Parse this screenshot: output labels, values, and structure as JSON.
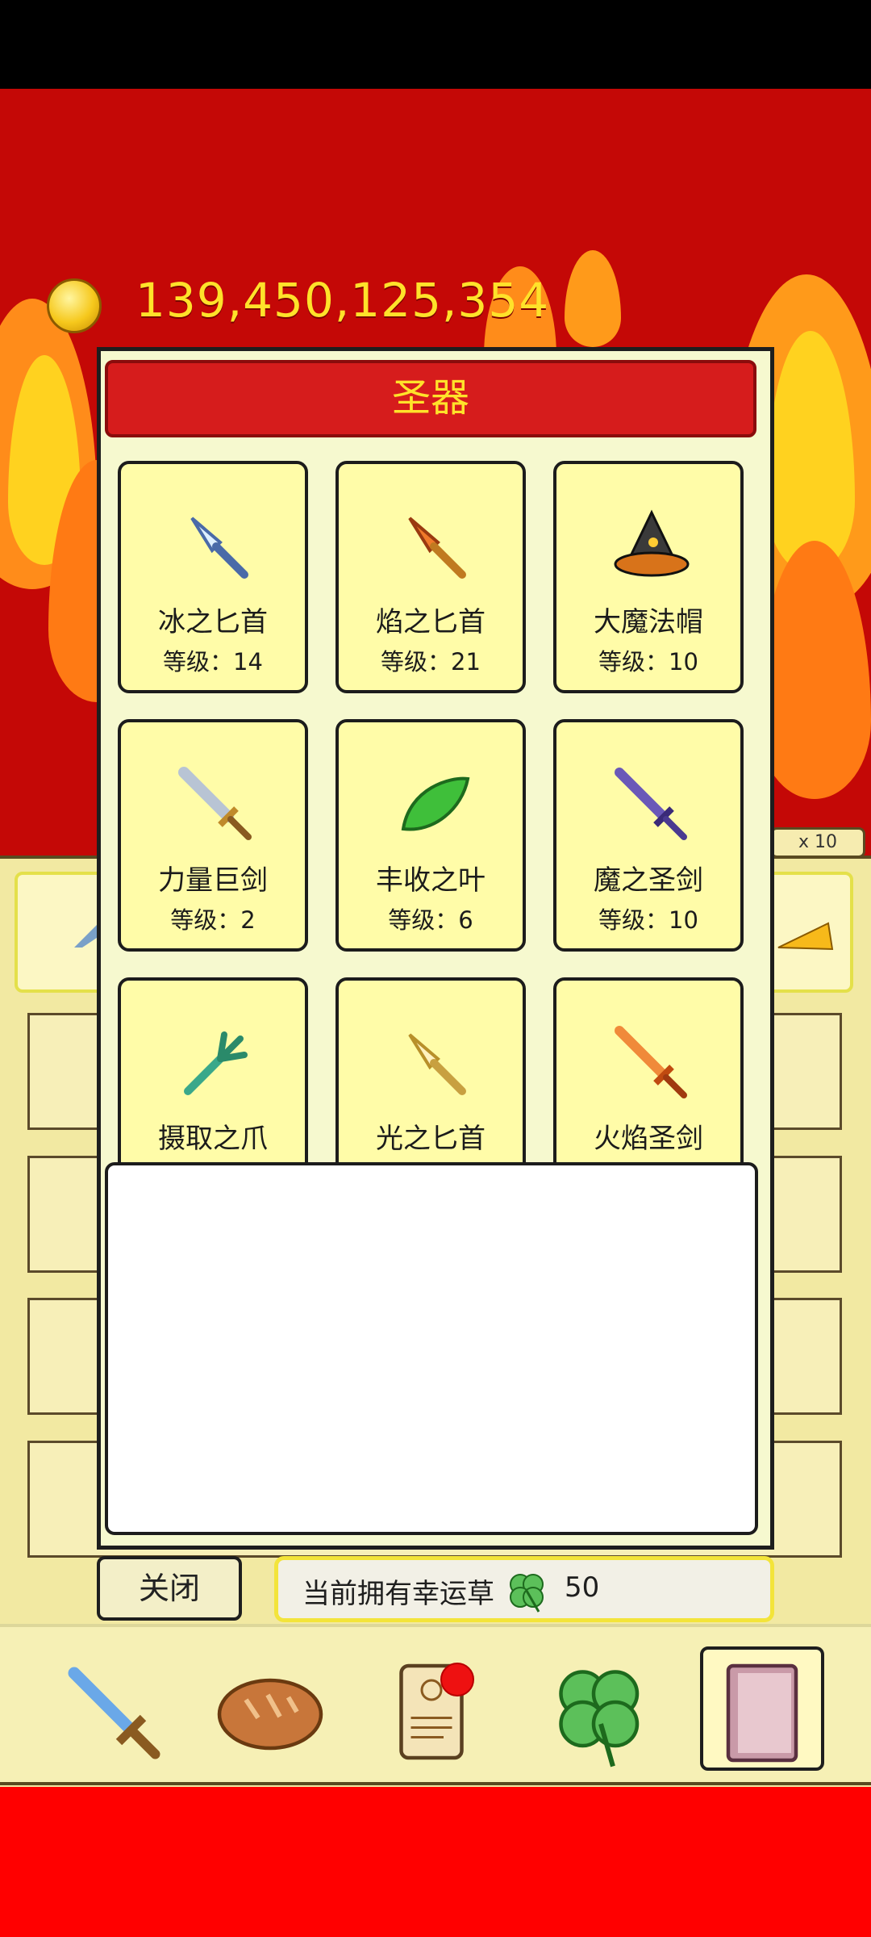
{
  "currency": {
    "amount": "139,450,125,354",
    "icon": "gold-coin-icon"
  },
  "multiplier_label": "x 10",
  "modal": {
    "title": "圣器",
    "items": [
      {
        "name": "冰之匕首",
        "level": "等级：14",
        "icon": "ice-dagger-icon"
      },
      {
        "name": "焰之匕首",
        "level": "等级：21",
        "icon": "flame-dagger-icon"
      },
      {
        "name": "大魔法帽",
        "level": "等级：10",
        "icon": "wizard-hat-icon"
      },
      {
        "name": "力量巨剑",
        "level": "等级：2",
        "icon": "great-sword-icon"
      },
      {
        "name": "丰收之叶",
        "level": "等级：6",
        "icon": "harvest-leaf-icon"
      },
      {
        "name": "魔之圣剑",
        "level": "等级：10",
        "icon": "demon-sword-icon"
      },
      {
        "name": "摄取之爪",
        "level": "",
        "icon": "grab-claw-icon"
      },
      {
        "name": "光之匕首",
        "level": "",
        "icon": "light-dagger-icon"
      },
      {
        "name": "火焰圣剑",
        "level": "",
        "icon": "fire-sword-icon"
      }
    ],
    "close_label": "关闭",
    "clover_label": "当前拥有幸运草",
    "clover_count": "50"
  },
  "nav": [
    {
      "name": "sword",
      "icon": "sword-icon"
    },
    {
      "name": "bread",
      "icon": "bread-icon"
    },
    {
      "name": "scroll",
      "icon": "scroll-icon",
      "badge": true
    },
    {
      "name": "clover",
      "icon": "clover-icon"
    },
    {
      "name": "book",
      "icon": "book-icon",
      "active": true
    }
  ],
  "colors": {
    "background_red": "#c40806",
    "title_red": "#d61c1c",
    "gold_text": "#ffe22a",
    "card_yellow": "#fffca8"
  }
}
